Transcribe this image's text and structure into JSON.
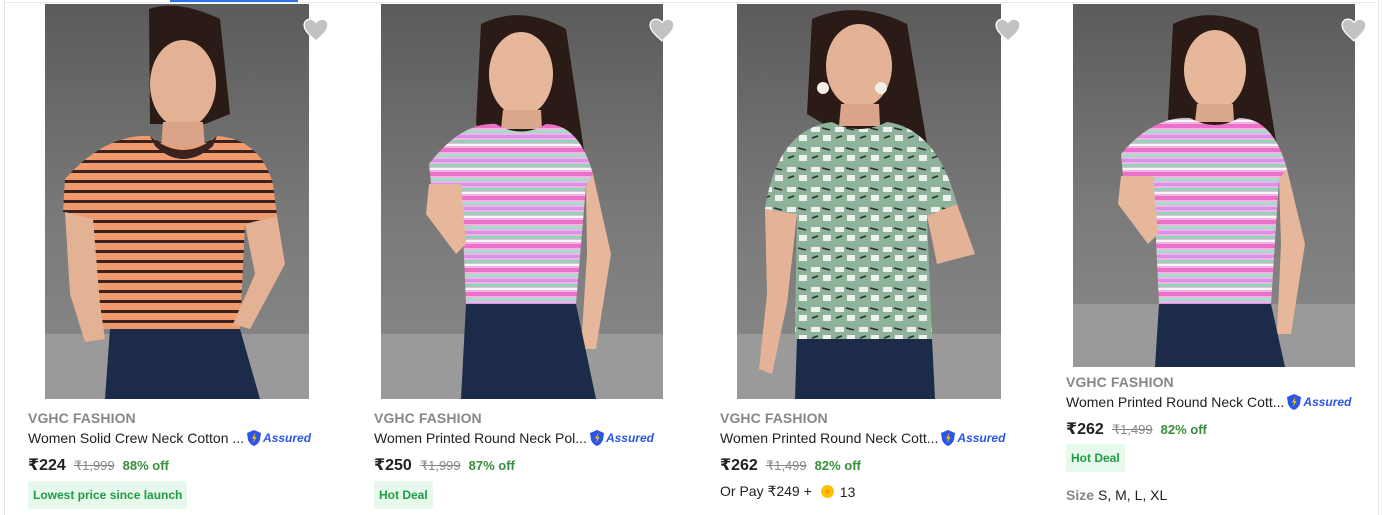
{
  "colors": {
    "accent": "#2874f0",
    "discount": "#388e3c",
    "deal_bg": "#e7f8ec",
    "deal_text": "#1f9d46",
    "assured": "#2a55e5",
    "muted": "#878787"
  },
  "products": [
    {
      "brand": "VGHC FASHION",
      "title": "Women Solid Crew Neck Cotton ...",
      "assured_label": "Assured",
      "price": "₹224",
      "mrp": "₹1,999",
      "discount": "88% off",
      "tag": "Lowest price since launch",
      "image_icon": "product-photo",
      "wishlist_icon": "heart-icon"
    },
    {
      "brand": "VGHC FASHION",
      "title": "Women Printed Round Neck Pol...",
      "assured_label": "Assured",
      "price": "₹250",
      "mrp": "₹1,999",
      "discount": "87% off",
      "tag": "Hot Deal",
      "image_icon": "product-photo",
      "wishlist_icon": "heart-icon"
    },
    {
      "brand": "VGHC FASHION",
      "title": "Women Printed Round Neck Cott...",
      "assured_label": "Assured",
      "price": "₹262",
      "mrp": "₹1,499",
      "discount": "82% off",
      "or_pay": "Or Pay ₹249 +",
      "coins": "13",
      "image_icon": "product-photo",
      "wishlist_icon": "heart-icon"
    },
    {
      "brand": "VGHC FASHION",
      "title": "Women Printed Round Neck Cott...",
      "assured_label": "Assured",
      "price": "₹262",
      "mrp": "₹1,499",
      "discount": "82% off",
      "tag": "Hot Deal",
      "size_label": "Size",
      "sizes": "S, M, L, XL",
      "image_icon": "product-photo",
      "wishlist_icon": "heart-icon"
    }
  ]
}
